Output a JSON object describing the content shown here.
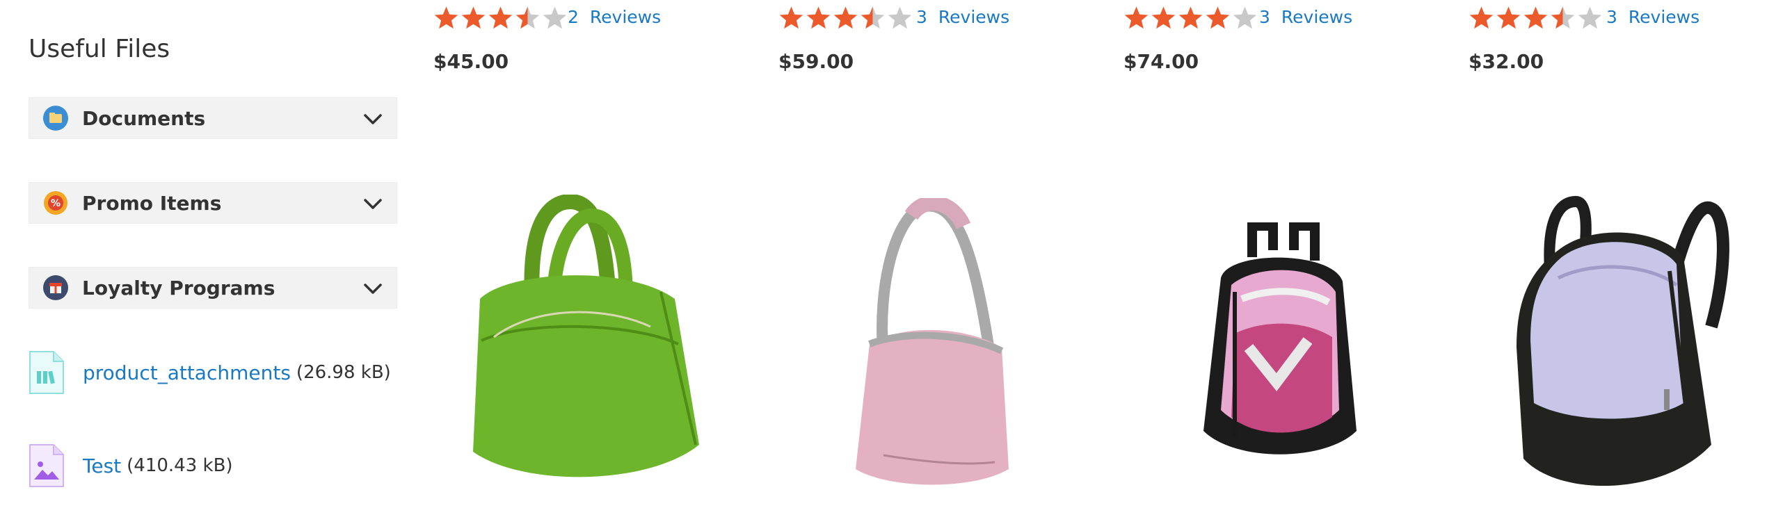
{
  "sidebar": {
    "title": "Useful Files",
    "accordions": [
      {
        "label": "Documents",
        "icon": "folder-icon"
      },
      {
        "label": "Promo Items",
        "icon": "percent-badge-icon"
      },
      {
        "label": "Loyalty Programs",
        "icon": "gift-icon"
      }
    ],
    "files": [
      {
        "name": "product_attachments",
        "size": "(26.98 kB)",
        "icon": "archive-file-icon"
      },
      {
        "name": "Test",
        "size": "(410.43 kB)",
        "icon": "image-file-icon"
      }
    ]
  },
  "products": [
    {
      "rating": 3.5,
      "reviews_count": "2",
      "reviews_label": "Reviews",
      "price": "$45.00",
      "image": "green-duffle-bag-image"
    },
    {
      "rating": 3.5,
      "reviews_count": "3",
      "reviews_label": "Reviews",
      "price": "$59.00",
      "image": "pink-shoulder-bag-image"
    },
    {
      "rating": 4,
      "reviews_count": "3",
      "reviews_label": "Reviews",
      "price": "$74.00",
      "image": "pink-black-backpack-image"
    },
    {
      "rating": 3.5,
      "reviews_count": "3",
      "reviews_label": "Reviews",
      "price": "$32.00",
      "image": "lavender-backpack-image"
    }
  ],
  "colors": {
    "star": "#ec5a2b",
    "star_empty": "#c8c8c8",
    "link": "#1979c3",
    "accordion_bg": "#f2f2f2"
  }
}
